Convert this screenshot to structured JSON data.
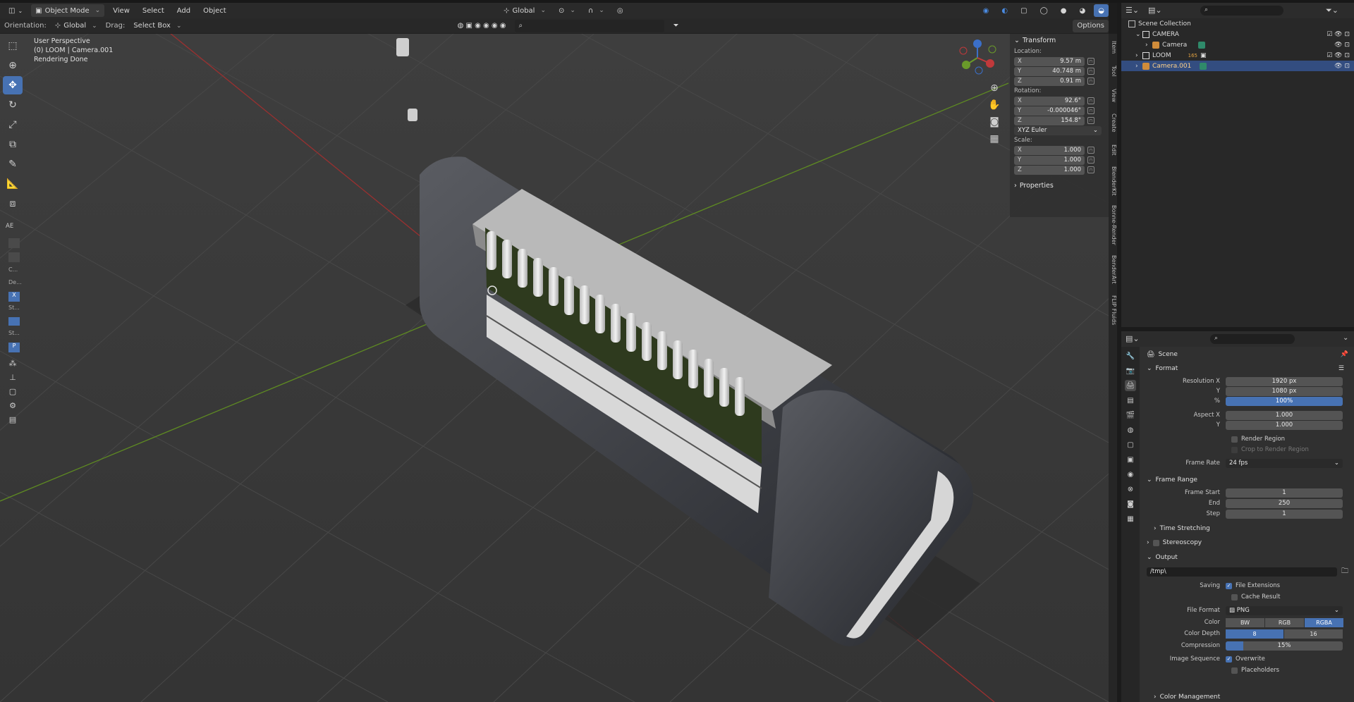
{
  "header": {
    "mode": "Object Mode",
    "menus": [
      "View",
      "Select",
      "Add",
      "Object"
    ],
    "transform_space": "Global",
    "options_label": "Options"
  },
  "header2": {
    "orientation_label": "Orientation:",
    "orientation_value": "Global",
    "drag_label": "Drag:",
    "drag_value": "Select Box"
  },
  "viewport": {
    "line1": "User Perspective",
    "line2": "(0) LOOM | Camera.001",
    "line3": "Rendering Done",
    "left_labels": [
      "AE",
      "C...",
      "De...",
      "X",
      "St...",
      "St...",
      "P"
    ]
  },
  "npanel": {
    "transform_title": "Transform",
    "location_label": "Location:",
    "location": [
      {
        "k": "X",
        "v": "9.57 m"
      },
      {
        "k": "Y",
        "v": "40.748 m"
      },
      {
        "k": "Z",
        "v": "0.91 m"
      }
    ],
    "rotation_label": "Rotation:",
    "rotation": [
      {
        "k": "X",
        "v": "92.6°"
      },
      {
        "k": "Y",
        "v": "-0.000046°"
      },
      {
        "k": "Z",
        "v": "154.8°"
      }
    ],
    "rotation_mode": "XYZ Euler",
    "scale_label": "Scale:",
    "scale": [
      {
        "k": "X",
        "v": "1.000"
      },
      {
        "k": "Y",
        "v": "1.000"
      },
      {
        "k": "Z",
        "v": "1.000"
      }
    ],
    "properties_title": "Properties"
  },
  "vtabs": [
    "Item",
    "Tool",
    "View",
    "Create",
    "Edit",
    "BlenderKit",
    "Bonne-Render",
    "BenderArt",
    "FLIP Fluids"
  ],
  "outliner": {
    "root": "Scene Collection",
    "items": [
      {
        "name": "CAMERA",
        "indent": 0
      },
      {
        "name": "Camera",
        "indent": 1
      },
      {
        "name": "LOOM",
        "indent": 0
      },
      {
        "name": "Camera.001",
        "indent": 0,
        "selected": true
      }
    ],
    "loom_badge": "165"
  },
  "properties": {
    "scene_label": "Scene",
    "format": {
      "title": "Format",
      "resolution_x_label": "Resolution X",
      "resolution_x": "1920 px",
      "y_label": "Y",
      "resolution_y": "1080 px",
      "pct_label": "%",
      "resolution_pct": "100%",
      "aspect_x_label": "Aspect X",
      "aspect_x": "1.000",
      "aspect_y_label": "Y",
      "aspect_y": "1.000",
      "render_region": "Render Region",
      "crop_region": "Crop to Render Region",
      "frame_rate_label": "Frame Rate",
      "frame_rate": "24 fps"
    },
    "frame_range": {
      "title": "Frame Range",
      "start_label": "Frame Start",
      "start": "1",
      "end_label": "End",
      "end": "250",
      "step_label": "Step",
      "step": "1"
    },
    "time_stretching": "Time Stretching",
    "stereoscopy": "Stereoscopy",
    "output": {
      "title": "Output",
      "path": "/tmp\\",
      "saving_label": "Saving",
      "file_extensions": "File Extensions",
      "cache_result": "Cache Result",
      "file_format_label": "File Format",
      "file_format": "PNG",
      "color_label": "Color",
      "color_options": [
        "BW",
        "RGB",
        "RGBA"
      ],
      "color_depth_label": "Color Depth",
      "color_depth_options": [
        "8",
        "16"
      ],
      "compression_label": "Compression",
      "compression": "15%",
      "compression_fraction": 0.15,
      "image_sequence_label": "Image Sequence",
      "overwrite": "Overwrite",
      "placeholders": "Placeholders"
    },
    "color_management": "Color Management"
  },
  "colors": {
    "accent": "#4772b3",
    "x_axis": "#c0393b",
    "y_axis": "#6a9a2a"
  }
}
